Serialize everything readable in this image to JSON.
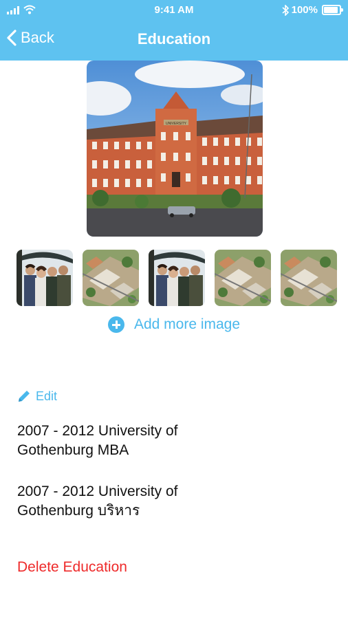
{
  "status_bar": {
    "time": "9:41 AM",
    "battery": "100%",
    "battery_level": 1.0
  },
  "nav": {
    "back_label": "Back",
    "title": "Education"
  },
  "hero_image": {
    "sign_text": "UNIVERSITY"
  },
  "gallery": {
    "add_more_label": "Add more image"
  },
  "edit_label": "Edit",
  "education": [
    {
      "text": "2007 - 2012 University of Gothenburg MBA"
    },
    {
      "text": "2007 - 2012 University of Gothenburg บริหาร"
    }
  ],
  "delete_label": "Delete Education",
  "colors": {
    "header": "#5ec2f0",
    "accent": "#4ab8ec",
    "danger": "#ee2a2a"
  },
  "icons": [
    "signal-icon",
    "wifi-icon",
    "bluetooth-icon",
    "battery-icon",
    "chevron-left-icon",
    "add-circle-icon",
    "pencil-icon"
  ]
}
